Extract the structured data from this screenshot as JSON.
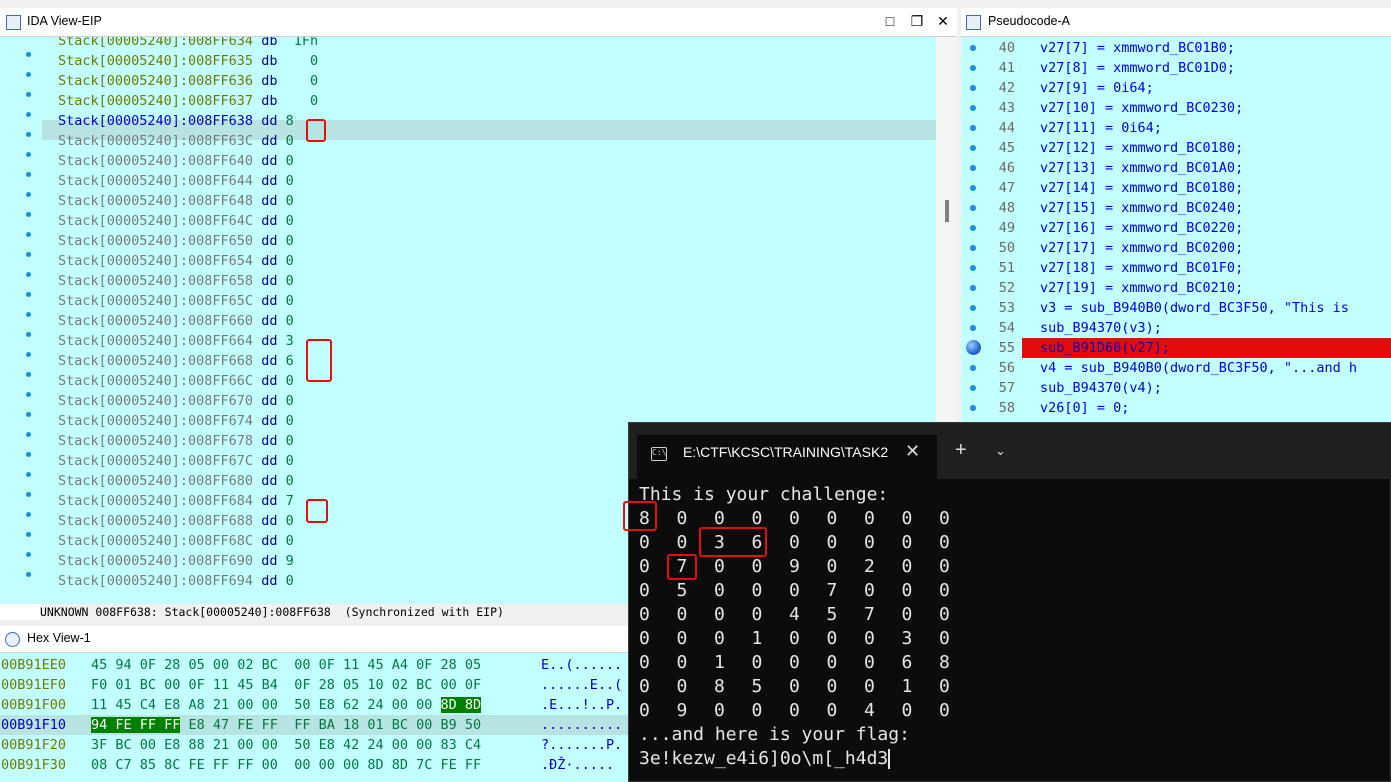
{
  "ida": {
    "title": "IDA View-EIP",
    "lines": [
      {
        "addr": "Stack[00005240]:008FF634",
        "type": "db",
        "value": " 1Fh"
      },
      {
        "addr": "Stack[00005240]:008FF635",
        "type": "db",
        "value": "   0"
      },
      {
        "addr": "Stack[00005240]:008FF636",
        "type": "db",
        "value": "   0"
      },
      {
        "addr": "Stack[00005240]:008FF637",
        "type": "db",
        "value": "   0"
      },
      {
        "addr": "Stack[00005240]:008FF638",
        "type": "dd",
        "value": "8"
      },
      {
        "addr": "Stack[00005240]:008FF63C",
        "type": "dd",
        "value": "0"
      },
      {
        "addr": "Stack[00005240]:008FF640",
        "type": "dd",
        "value": "0"
      },
      {
        "addr": "Stack[00005240]:008FF644",
        "type": "dd",
        "value": "0"
      },
      {
        "addr": "Stack[00005240]:008FF648",
        "type": "dd",
        "value": "0"
      },
      {
        "addr": "Stack[00005240]:008FF64C",
        "type": "dd",
        "value": "0"
      },
      {
        "addr": "Stack[00005240]:008FF650",
        "type": "dd",
        "value": "0"
      },
      {
        "addr": "Stack[00005240]:008FF654",
        "type": "dd",
        "value": "0"
      },
      {
        "addr": "Stack[00005240]:008FF658",
        "type": "dd",
        "value": "0"
      },
      {
        "addr": "Stack[00005240]:008FF65C",
        "type": "dd",
        "value": "0"
      },
      {
        "addr": "Stack[00005240]:008FF660",
        "type": "dd",
        "value": "0"
      },
      {
        "addr": "Stack[00005240]:008FF664",
        "type": "dd",
        "value": "3"
      },
      {
        "addr": "Stack[00005240]:008FF668",
        "type": "dd",
        "value": "6"
      },
      {
        "addr": "Stack[00005240]:008FF66C",
        "type": "dd",
        "value": "0"
      },
      {
        "addr": "Stack[00005240]:008FF670",
        "type": "dd",
        "value": "0"
      },
      {
        "addr": "Stack[00005240]:008FF674",
        "type": "dd",
        "value": "0"
      },
      {
        "addr": "Stack[00005240]:008FF678",
        "type": "dd",
        "value": "0"
      },
      {
        "addr": "Stack[00005240]:008FF67C",
        "type": "dd",
        "value": "0"
      },
      {
        "addr": "Stack[00005240]:008FF680",
        "type": "dd",
        "value": "0"
      },
      {
        "addr": "Stack[00005240]:008FF684",
        "type": "dd",
        "value": "7"
      },
      {
        "addr": "Stack[00005240]:008FF688",
        "type": "dd",
        "value": "0"
      },
      {
        "addr": "Stack[00005240]:008FF68C",
        "type": "dd",
        "value": "0"
      },
      {
        "addr": "Stack[00005240]:008FF690",
        "type": "dd",
        "value": "9"
      },
      {
        "addr": "Stack[00005240]:008FF694",
        "type": "dd",
        "value": "0"
      }
    ],
    "status_left": "UNKNOWN",
    "status_addr": "008FF638: Stack[00005240]:008FF638",
    "status_sync": "(Synchronized with EIP)"
  },
  "pseudo": {
    "title": "Pseudocode-A",
    "lines": [
      {
        "num": "40",
        "code": "v27[7] = xmmword_BC01B0;"
      },
      {
        "num": "41",
        "code": "v27[8] = xmmword_BC01D0;"
      },
      {
        "num": "42",
        "code": "v27[9] = 0i64;"
      },
      {
        "num": "43",
        "code": "v27[10] = xmmword_BC0230;"
      },
      {
        "num": "44",
        "code": "v27[11] = 0i64;"
      },
      {
        "num": "45",
        "code": "v27[12] = xmmword_BC0180;"
      },
      {
        "num": "46",
        "code": "v27[13] = xmmword_BC01A0;"
      },
      {
        "num": "47",
        "code": "v27[14] = xmmword_BC0180;"
      },
      {
        "num": "48",
        "code": "v27[15] = xmmword_BC0240;"
      },
      {
        "num": "49",
        "code": "v27[16] = xmmword_BC0220;"
      },
      {
        "num": "50",
        "code": "v27[17] = xmmword_BC0200;"
      },
      {
        "num": "51",
        "code": "v27[18] = xmmword_BC01F0;"
      },
      {
        "num": "52",
        "code": "v27[19] = xmmword_BC0210;"
      },
      {
        "num": "53",
        "code": "v3 = sub_B940B0(dword_BC3F50, \"This is"
      },
      {
        "num": "54",
        "code": "sub_B94370(v3);"
      },
      {
        "num": "55",
        "code": "sub_B91D60(v27);"
      },
      {
        "num": "56",
        "code": "v4 = sub_B940B0(dword_BC3F50, \"...and h"
      },
      {
        "num": "57",
        "code": "sub_B94370(v4);"
      },
      {
        "num": "58",
        "code": "v26[0] = 0;"
      }
    ]
  },
  "hex": {
    "title": "Hex View-1",
    "lines": [
      {
        "addr": "00B91EE0",
        "bytes": "45 94 0F 28 05 00 02 BC  00 0F 11 45 A4 0F 28 05",
        "ascii": "E..(......"
      },
      {
        "addr": "00B91EF0",
        "bytes": "F0 01 BC 00 0F 11 45 B4  0F 28 05 10 02 BC 00 0F",
        "ascii": "......E..("
      },
      {
        "addr": "00B91F00",
        "bytes_a": "11 45 C4 E8 A8 21 00 00  50 E8 62 24 00 00 ",
        "bytes_hl": "8D 8D",
        "ascii": ".E...!..P."
      },
      {
        "addr": "00B91F10",
        "bytes_hl": "94 FE FF FF",
        "bytes_b": " E8 47 FE FF  FF BA 18 01 BC 00 B9 50",
        "ascii": ".........."
      },
      {
        "addr": "00B91F20",
        "bytes": "3F BC 00 E8 88 21 00 00  50 E8 42 24 00 00 83 C4",
        "ascii": "?.......P."
      },
      {
        "addr": "00B91F30",
        "bytes": "08 C7 85 8C FE FF FF 00  00 00 00 8D 8D 7C FE FF",
        "ascii": ".ÐŽ·....."
      }
    ]
  },
  "terminal": {
    "tab_title": "E:\\CTF\\KCSC\\TRAINING\\TASK2",
    "icon_label": "C:\\",
    "new_tab": "+",
    "close": "✕",
    "dropdown": "⌄",
    "challenge_text": "This is your challenge:",
    "grid": [
      [
        "8",
        "0",
        "0",
        "0",
        "0",
        "0",
        "0",
        "0",
        "0"
      ],
      [
        "0",
        "0",
        "3",
        "6",
        "0",
        "0",
        "0",
        "0",
        "0"
      ],
      [
        "0",
        "7",
        "0",
        "0",
        "9",
        "0",
        "2",
        "0",
        "0"
      ],
      [
        "0",
        "5",
        "0",
        "0",
        "0",
        "7",
        "0",
        "0",
        "0"
      ],
      [
        "0",
        "0",
        "0",
        "0",
        "4",
        "5",
        "7",
        "0",
        "0"
      ],
      [
        "0",
        "0",
        "0",
        "1",
        "0",
        "0",
        "0",
        "3",
        "0"
      ],
      [
        "0",
        "0",
        "1",
        "0",
        "0",
        "0",
        "0",
        "6",
        "8"
      ],
      [
        "0",
        "0",
        "8",
        "5",
        "0",
        "0",
        "0",
        "1",
        "0"
      ],
      [
        "0",
        "9",
        "0",
        "0",
        "0",
        "0",
        "4",
        "0",
        "0"
      ]
    ],
    "flag_text": "...and here is your flag:",
    "flag_value": "3e!kezw_e4i6]0o\\m[_h4d3"
  },
  "colors": {
    "listing_bg": "#c2ffff",
    "highlight_red": "#e01010",
    "breakpoint_red": "#e60b0b",
    "terminal_bg": "#0c0c0c"
  }
}
